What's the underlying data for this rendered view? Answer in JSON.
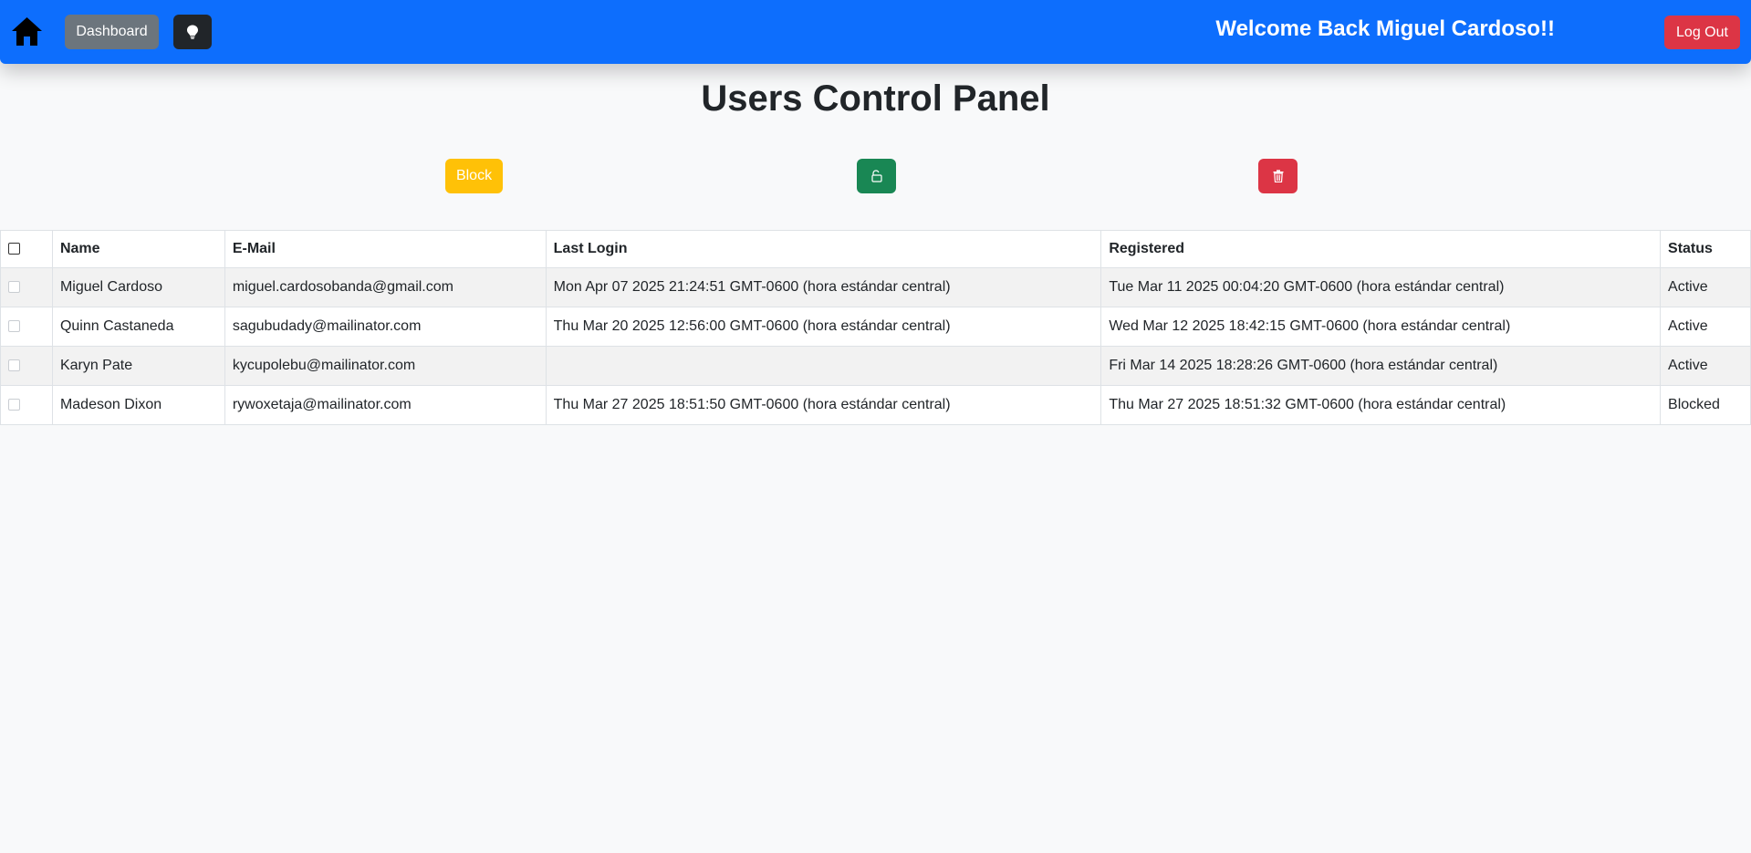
{
  "colors": {
    "navbar": "#0d6efd",
    "dashboard_button": "#6c757d",
    "theme_button": "#212529",
    "logout_button": "#dc3545",
    "block_button": "#ffc107",
    "unblock_button": "#198754",
    "delete_button": "#dc3545",
    "page_background": "#f8f9fa"
  },
  "navbar": {
    "home_icon": "home-icon",
    "dashboard_label": "Dashboard",
    "theme_icon": "lightbulb-icon",
    "welcome_text": "Welcome Back Miguel Cardoso!!",
    "logout_label": "Log Out"
  },
  "page": {
    "title": "Users Control Panel"
  },
  "toolbar": {
    "block_label": "Block",
    "unblock_icon": "unlock-icon",
    "delete_icon": "trash-icon"
  },
  "table": {
    "headers": {
      "name": "Name",
      "email": "E-Mail",
      "last_login": "Last Login",
      "registered": "Registered",
      "status": "Status"
    },
    "rows": [
      {
        "name": "Miguel Cardoso",
        "email": "miguel.cardosobanda@gmail.com",
        "last_login": "Mon Apr 07 2025 21:24:51 GMT-0600 (hora estándar central)",
        "registered": "Tue Mar 11 2025 00:04:20 GMT-0600 (hora estándar central)",
        "status": "Active"
      },
      {
        "name": "Quinn Castaneda",
        "email": "sagubudady@mailinator.com",
        "last_login": "Thu Mar 20 2025 12:56:00 GMT-0600 (hora estándar central)",
        "registered": "Wed Mar 12 2025 18:42:15 GMT-0600 (hora estándar central)",
        "status": "Active"
      },
      {
        "name": "Karyn Pate",
        "email": "kycupolebu@mailinator.com",
        "last_login": "",
        "registered": "Fri Mar 14 2025 18:28:26 GMT-0600 (hora estándar central)",
        "status": "Active"
      },
      {
        "name": "Madeson Dixon",
        "email": "rywoxetaja@mailinator.com",
        "last_login": "Thu Mar 27 2025 18:51:50 GMT-0600 (hora estándar central)",
        "registered": "Thu Mar 27 2025 18:51:32 GMT-0600 (hora estándar central)",
        "status": "Blocked"
      }
    ]
  }
}
